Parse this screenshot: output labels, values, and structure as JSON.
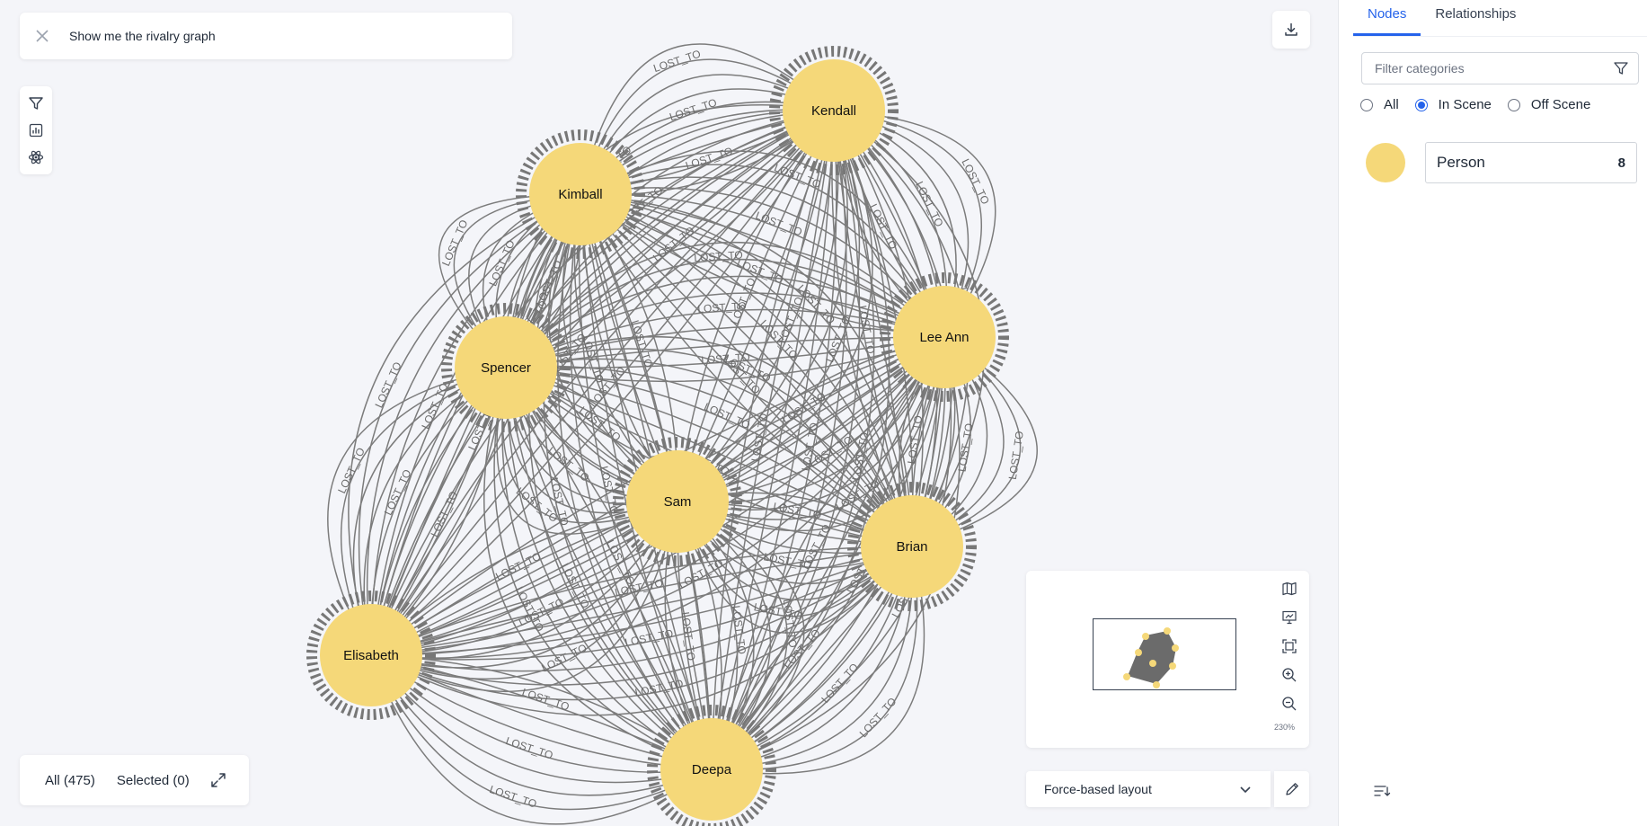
{
  "search": {
    "query": "Show me the rivalry graph",
    "close_icon": "close-icon"
  },
  "toolbar": {
    "icons": [
      "filter-icon",
      "chart-icon",
      "graph-style-icon"
    ]
  },
  "download": {
    "icon": "download-icon"
  },
  "selection": {
    "all_label": "All (475)",
    "selected_label": "Selected (0)",
    "expand_icon": "expand-icon"
  },
  "graph": {
    "edge_label": "LOST_TO",
    "node_color": "#f5d879",
    "edge_color": "#7c7c7c",
    "nodes": [
      {
        "id": "Kendall",
        "label": "Kendall"
      },
      {
        "id": "Kimball",
        "label": "Kimball"
      },
      {
        "id": "Lee Ann",
        "label": "Lee Ann"
      },
      {
        "id": "Spencer",
        "label": "Spencer"
      },
      {
        "id": "Sam",
        "label": "Sam"
      },
      {
        "id": "Brian",
        "label": "Brian"
      },
      {
        "id": "Elisabeth",
        "label": "Elisabeth"
      },
      {
        "id": "Deepa",
        "label": "Deepa"
      }
    ]
  },
  "minimap": {
    "zoom_label": "230%",
    "tool_icons": [
      "map-icon",
      "presentation-icon",
      "fit-screen-icon",
      "zoom-in-icon",
      "zoom-out-icon"
    ]
  },
  "layout": {
    "selected": "Force-based layout",
    "dropdown_icon": "chevron-down-icon",
    "edit_icon": "pencil-icon"
  },
  "sidebar": {
    "tabs": [
      {
        "label": "Nodes",
        "active": true
      },
      {
        "label": "Relationships",
        "active": false
      }
    ],
    "filter_placeholder": "Filter categories",
    "scope_options": [
      {
        "label": "All",
        "checked": false
      },
      {
        "label": "In Scene",
        "checked": true
      },
      {
        "label": "Off Scene",
        "checked": false
      }
    ],
    "categories": [
      {
        "label": "Person",
        "count": "8",
        "color": "#f5d879"
      }
    ]
  }
}
